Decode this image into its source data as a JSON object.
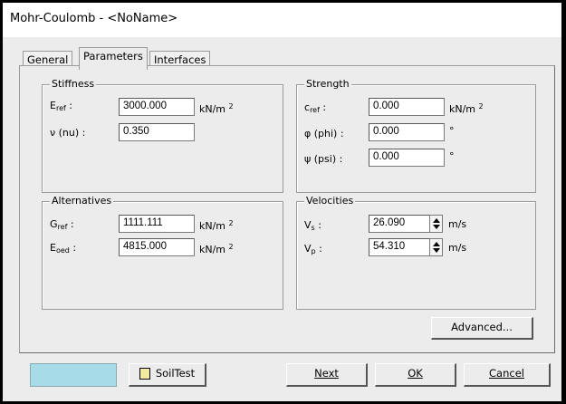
{
  "window": {
    "title": "Mohr-Coulomb - <NoName>"
  },
  "tabs": [
    {
      "label": "General",
      "active": false
    },
    {
      "label": "Parameters",
      "active": true
    },
    {
      "label": "Interfaces",
      "active": false
    }
  ],
  "stiffness": {
    "title": "Stiffness",
    "e_ref": {
      "sym": "E",
      "sub": "ref",
      "value": "3000.000",
      "unit": "kN/m",
      "unit_exp": "2"
    },
    "nu": {
      "label": "ν (nu) :",
      "value": "0.350"
    }
  },
  "strength": {
    "title": "Strength",
    "c_ref": {
      "sym": "c",
      "sub": "ref",
      "value": "0.000",
      "unit": "kN/m",
      "unit_exp": "2"
    },
    "phi": {
      "label": "φ (phi) :",
      "value": "0.000",
      "unit": "°"
    },
    "psi": {
      "label": "ψ (psi) :",
      "value": "0.000",
      "unit": "°"
    }
  },
  "alternatives": {
    "title": "Alternatives",
    "g_ref": {
      "sym": "G",
      "sub": "ref",
      "value": "1111.111",
      "unit": "kN/m",
      "unit_exp": "2"
    },
    "e_oed": {
      "sym": "E",
      "sub": "oed",
      "value": "4815.000",
      "unit": "kN/m",
      "unit_exp": "2"
    }
  },
  "velocities": {
    "title": "Velocities",
    "vs": {
      "sym": "V",
      "sub": "s",
      "value": "26.090",
      "unit": "m/s"
    },
    "vp": {
      "sym": "V",
      "sub": "p",
      "value": "54.310",
      "unit": "m/s"
    }
  },
  "buttons": {
    "advanced": "Advanced...",
    "soiltest": "SoilTest",
    "next": "Next",
    "ok": "OK",
    "cancel": "Cancel"
  },
  "colors": {
    "swatch": "#a6dbe7"
  }
}
